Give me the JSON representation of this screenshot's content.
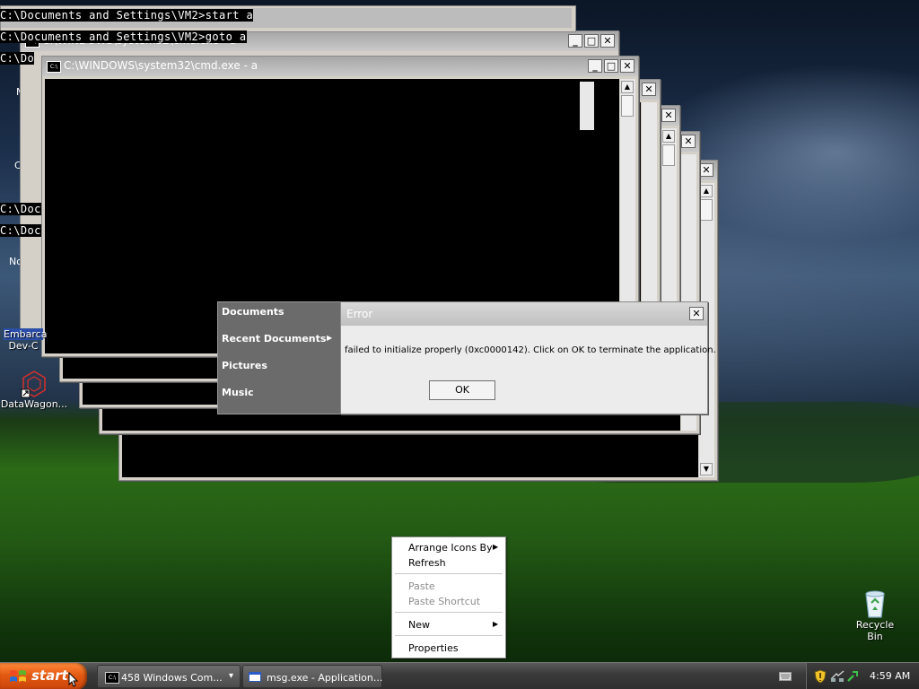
{
  "console_text": {
    "line1": "C:\\Documents and Settings\\VM2>start a",
    "line2": "C:\\Documents and Settings\\VM2>goto a",
    "line3": "C:\\Do",
    "line4": "C:\\Documents a",
    "line5": "C:\\Documents a"
  },
  "windows": {
    "cmd_title_partial": "C:\\WINDOWS\\system32\\cmd.exe - a",
    "cmd_title_front": "C:\\WINDOWS\\system32\\cmd.exe - a",
    "icon_text": "C:\\",
    "btn_minimize": "_",
    "btn_maximize": "□",
    "btn_close": "✕",
    "scroll_up": "▲",
    "scroll_down": "▼"
  },
  "desktop_fragments": {
    "left_1": "M",
    "left_2": "C",
    "left_3": "No"
  },
  "desktop_icons": {
    "embarcadero_line1": "Embarca",
    "embarcadero_line2": "Dev-C",
    "datawagon": "DataWagon...",
    "recycle_bin": "Recycle Bin"
  },
  "start_menu": {
    "items": [
      "Documents",
      "Recent Documents",
      "Pictures",
      "Music"
    ],
    "submenu_arrow": "▶"
  },
  "error_dialog": {
    "title": "Error",
    "message": "failed to initialize properly (0xc0000142). Click on OK to terminate the application.",
    "ok_label": "OK",
    "close": "✕"
  },
  "context_menu": {
    "arrange": "Arrange Icons By",
    "refresh": "Refresh",
    "paste": "Paste",
    "paste_shortcut": "Paste Shortcut",
    "new": "New",
    "properties": "Properties",
    "submenu_arrow": "▶"
  },
  "taskbar": {
    "start_label": "start",
    "task1": "458 Windows Com...",
    "task1_dropdown": "▾",
    "task2": "msg.exe - Application...",
    "clock": "4:59 AM"
  },
  "colors": {
    "start_orange": "#e35a12",
    "console_black": "#000000",
    "titlebar_gray": "#bcbcbc",
    "menu_gray": "#6b6b6b"
  }
}
